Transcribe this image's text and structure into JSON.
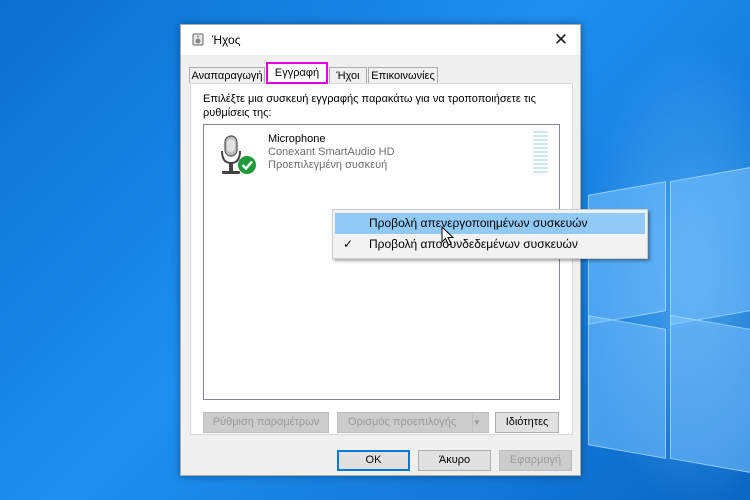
{
  "window": {
    "title": "Ήχος",
    "close_glyph": "✕",
    "icon": "speaker-icon"
  },
  "tabs": [
    {
      "label": "Αναπαραγωγή",
      "active": false
    },
    {
      "label": "Εγγραφή",
      "active": true
    },
    {
      "label": "Ήχοι",
      "active": false
    },
    {
      "label": "Επικοινωνίες",
      "active": false
    }
  ],
  "recording": {
    "instructions": "Επιλέξτε μια συσκευή εγγραφής παρακάτω για να τροποποιήσετε τις ρυθμίσεις της:",
    "device": {
      "name": "Microphone",
      "driver": "Conexant SmartAudio HD",
      "status": "Προεπιλεγμένη συσκευή",
      "icon": "microphone-icon",
      "badge_icon": "default-check-icon"
    }
  },
  "context_menu": {
    "items": [
      {
        "label": "Προβολή απενεργοποιημένων συσκευών",
        "checked": false,
        "highlighted": true
      },
      {
        "label": "Προβολή αποσυνδεδεμένων συσκευών",
        "checked": true,
        "highlighted": false
      }
    ],
    "check_glyph": "✓"
  },
  "actions": {
    "configure": "Ρύθμιση παραμέτρων",
    "set_default": "Ορισμός προεπιλογής",
    "properties": "Ιδιότητες"
  },
  "footer": {
    "ok": "OK",
    "cancel": "Άκυρο",
    "apply": "Εφαρμογή"
  },
  "colors": {
    "tab_highlight": "#e000e0",
    "menu_hover": "#91c9f7",
    "accent": "#0078d7",
    "check_green": "#1e9a3c"
  }
}
